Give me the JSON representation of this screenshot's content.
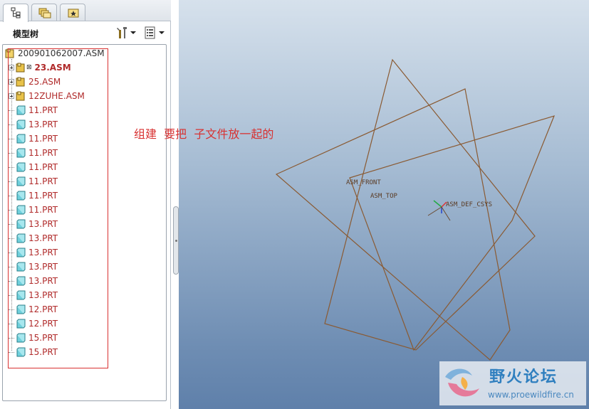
{
  "model_tree": {
    "title": "模型树",
    "root": "200901062007.ASM",
    "items": [
      {
        "label": "23.ASM",
        "type": "asm",
        "expandable": true,
        "bold": true,
        "flag": "⊠"
      },
      {
        "label": "25.ASM",
        "type": "asm",
        "expandable": true,
        "bold": false
      },
      {
        "label": "12ZUHE.ASM",
        "type": "asm",
        "expandable": true,
        "bold": false
      },
      {
        "label": "11.PRT",
        "type": "prt"
      },
      {
        "label": "13.PRT",
        "type": "prt"
      },
      {
        "label": "11.PRT",
        "type": "prt"
      },
      {
        "label": "11.PRT",
        "type": "prt"
      },
      {
        "label": "11.PRT",
        "type": "prt"
      },
      {
        "label": "11.PRT",
        "type": "prt"
      },
      {
        "label": "11.PRT",
        "type": "prt"
      },
      {
        "label": "11.PRT",
        "type": "prt"
      },
      {
        "label": "13.PRT",
        "type": "prt"
      },
      {
        "label": "13.PRT",
        "type": "prt"
      },
      {
        "label": "13.PRT",
        "type": "prt"
      },
      {
        "label": "13.PRT",
        "type": "prt"
      },
      {
        "label": "13.PRT",
        "type": "prt"
      },
      {
        "label": "13.PRT",
        "type": "prt"
      },
      {
        "label": "12.PRT",
        "type": "prt"
      },
      {
        "label": "12.PRT",
        "type": "prt"
      },
      {
        "label": "15.PRT",
        "type": "prt"
      },
      {
        "label": "15.PRT",
        "type": "prt"
      }
    ]
  },
  "annotation": {
    "text": "组建  要把  子文件放一起的",
    "color": "#d83232"
  },
  "graphics": {
    "datum_labels": {
      "front": "ASM_FRONT",
      "top": "ASM_TOP",
      "csys": "ASM_DEF_CSYS"
    }
  },
  "watermark": {
    "title": "野火论坛",
    "url": "www.proewildfire.cn"
  },
  "colors": {
    "datum_plane": "#8a5a32",
    "tree_text": "#b02a2a",
    "asm_icon": "#e8c24a",
    "prt_icon": "#6fd0dc"
  }
}
